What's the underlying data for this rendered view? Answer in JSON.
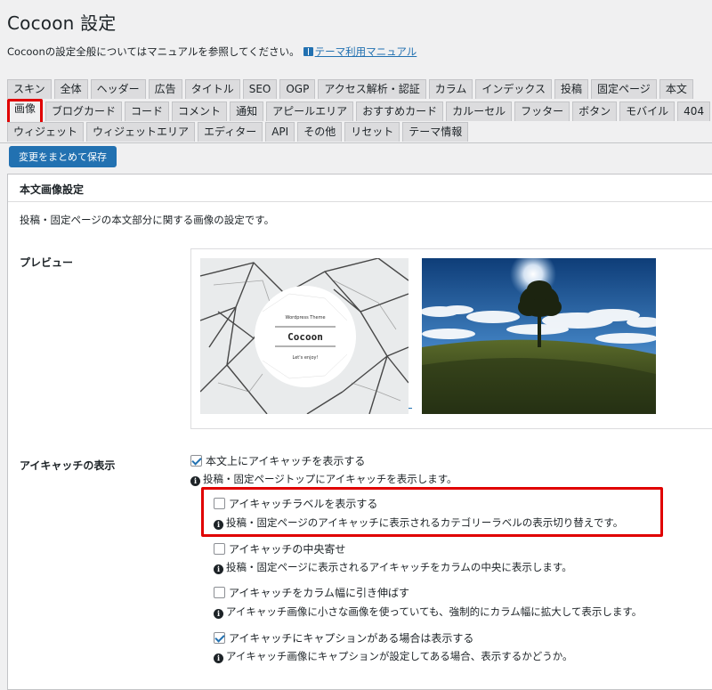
{
  "page": {
    "title": "Cocoon 設定",
    "intro_text": "Cocoonの設定全般についてはマニュアルを参照してください。",
    "manual_link": "テーマ利用マニュアル"
  },
  "tabs": {
    "row1": [
      "スキン",
      "全体",
      "ヘッダー",
      "広告",
      "タイトル",
      "SEO",
      "OGP",
      "アクセス解析・認証",
      "カラム",
      "インデックス",
      "投稿",
      "固定ページ",
      "本文"
    ],
    "row2": [
      "画像",
      "ブログカード",
      "コード",
      "コメント",
      "通知",
      "アピールエリア",
      "おすすめカード",
      "カルーセル",
      "フッター",
      "ボタン",
      "モバイル",
      "404"
    ],
    "row3": [
      "ウィジェット",
      "ウィジェットエリア",
      "エディター",
      "API",
      "その他",
      "リセット",
      "テーマ情報"
    ],
    "active": "画像"
  },
  "save_button": "変更をまとめて保存",
  "section": {
    "title": "本文画像設定",
    "description": "投稿・固定ページの本文部分に関する画像の設定です。"
  },
  "preview": {
    "label": "プレビュー",
    "thumb_small": "Wordpress Theme",
    "thumb_title": "Cocoon",
    "thumb_tagline": "Let's enjoy!"
  },
  "eyecatch": {
    "label": "アイキャッチの表示",
    "options": [
      {
        "label": "本文上にアイキャッチを表示する",
        "checked": true,
        "info": "投稿・固定ページトップにアイキャッチを表示します。"
      },
      {
        "label": "アイキャッチラベルを表示する",
        "checked": false,
        "info": "投稿・固定ページのアイキャッチに表示されるカテゴリーラベルの表示切り替えです。"
      },
      {
        "label": "アイキャッチの中央寄せ",
        "checked": false,
        "info": "投稿・固定ページに表示されるアイキャッチをカラムの中央に表示します。"
      },
      {
        "label": "アイキャッチをカラム幅に引き伸ばす",
        "checked": false,
        "info": "アイキャッチ画像に小さな画像を使っていても、強制的にカラム幅に拡大して表示します。"
      },
      {
        "label": "アイキャッチにキャプションがある場合は表示する",
        "checked": true,
        "info": "アイキャッチ画像にキャプションが設定してある場合、表示するかどうか。"
      }
    ]
  },
  "colors": {
    "accent": "#2271b1",
    "highlight": "#e00000",
    "background": "#f0f0f1"
  }
}
